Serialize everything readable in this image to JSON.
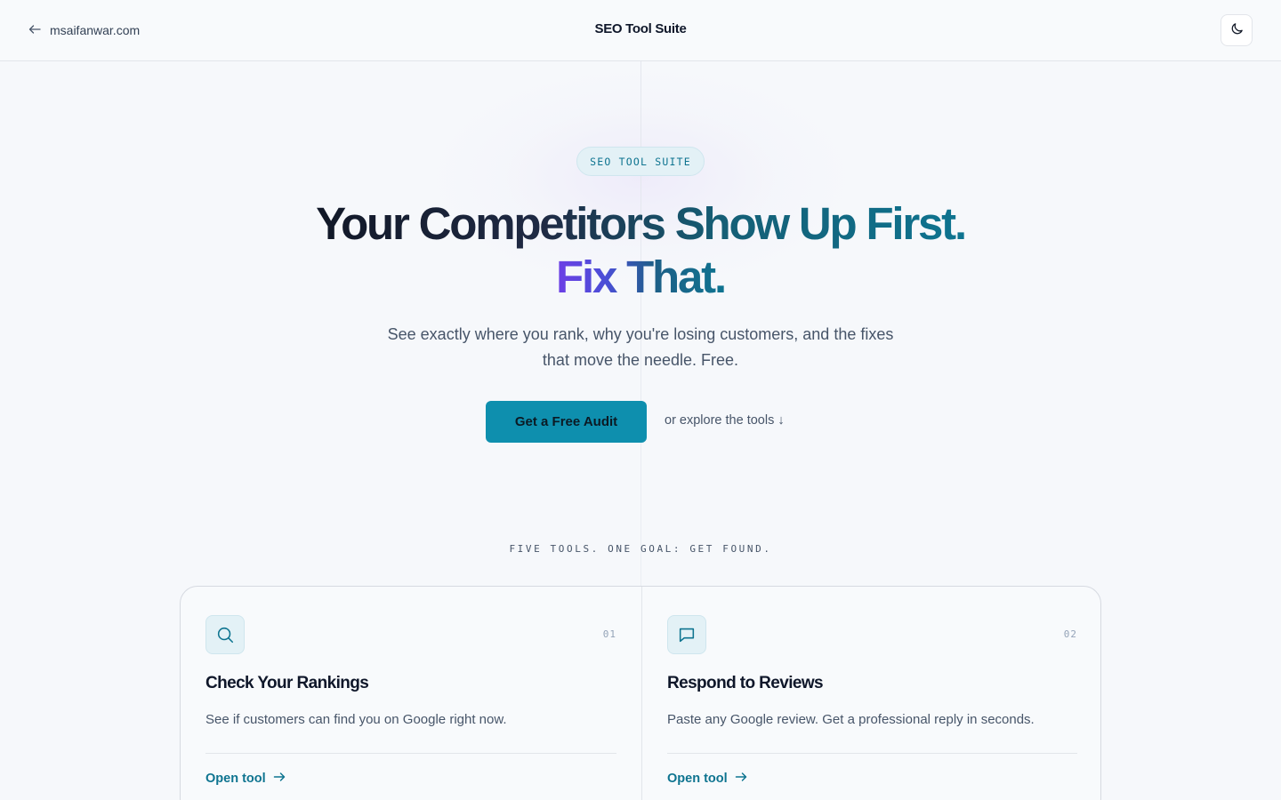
{
  "header": {
    "back_label": "msaifanwar.com",
    "back_icon": "arrow-left-icon",
    "title": "SEO Tool Suite",
    "theme_icon": "moon-icon"
  },
  "hero": {
    "badge": "SEO TOOL SUITE",
    "headline_line1": "Your Competitors Show Up First.",
    "headline_line2": "Fix That.",
    "subtitle": "See exactly where you rank, why you're losing customers, and the fixes that move the needle. Free.",
    "cta_label": "Get a Free Audit",
    "explore_label": "or explore the tools ↓"
  },
  "tools": {
    "kicker": "FIVE TOOLS. ONE GOAL: GET FOUND.",
    "cards": [
      {
        "icon": "search-icon",
        "number": "01",
        "title": "Check Your Rankings",
        "description": "See if customers can find you on Google right now.",
        "link_label": "Open tool"
      },
      {
        "icon": "message-icon",
        "number": "02",
        "title": "Respond to Reviews",
        "description": "Paste any Google review. Get a professional reply in seconds.",
        "link_label": "Open tool"
      }
    ]
  },
  "colors": {
    "accent": "#0e8fae",
    "accent_text": "#0e7490",
    "gradient_purple": "#6d3fe6",
    "background": "#f6f8fb"
  }
}
